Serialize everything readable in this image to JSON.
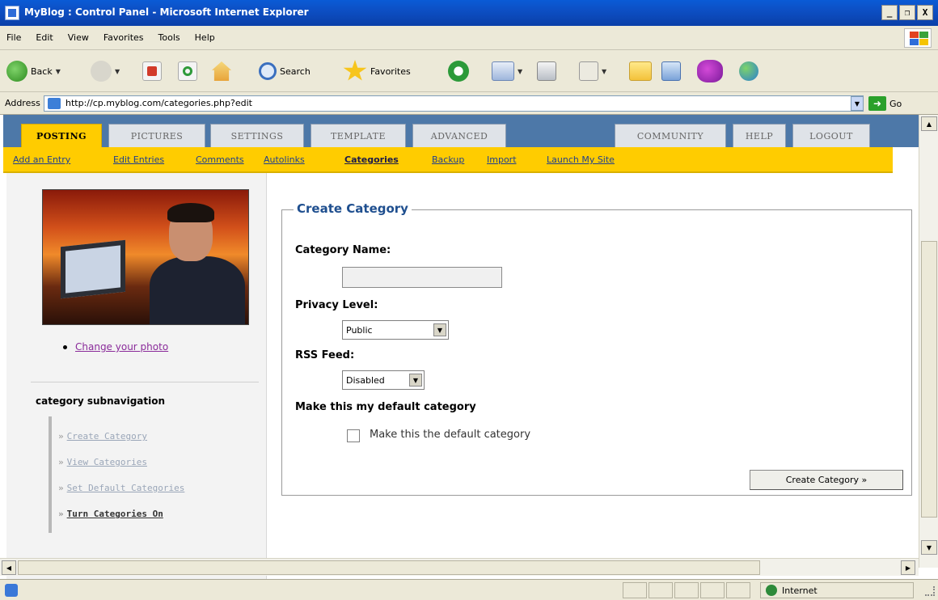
{
  "window": {
    "title": "MyBlog : Control Panel - Microsoft Internet Explorer",
    "buttons": [
      "_",
      "❐",
      "X"
    ]
  },
  "menubar": {
    "items": [
      "File",
      "Edit",
      "View",
      "Favorites",
      "Tools",
      "Help"
    ]
  },
  "toolbar": {
    "back_label": "Back",
    "search_label": "Search",
    "favorites_label": "Favorites"
  },
  "addressbar": {
    "label": "Address",
    "url": "http://cp.myblog.com/categories.php?edit",
    "go_label": "Go"
  },
  "tabs": {
    "left": [
      "POSTING",
      "PICTURES",
      "SETTINGS",
      "TEMPLATE",
      "ADVANCED"
    ],
    "right": [
      "COMMUNITY",
      "HELP",
      "LOGOUT"
    ],
    "active": "POSTING"
  },
  "subnav": {
    "items": [
      "Add an Entry",
      "Edit Entries",
      "Comments",
      "Autolinks",
      "Categories",
      "Backup",
      "Import",
      "Launch My Site"
    ],
    "current": "Categories"
  },
  "sidebar": {
    "change_photo": "Change your photo",
    "subnav_heading": "category subnavigation",
    "subnav_items": [
      "Create Category",
      "View Categories",
      "Set Default Categories",
      "Turn Categories On"
    ],
    "raquo": "»"
  },
  "form": {
    "legend": "Create Category",
    "category_name_label": "Category Name:",
    "category_name_value": "",
    "privacy_label": "Privacy Level:",
    "privacy_value": "Public",
    "rss_label": "RSS Feed:",
    "rss_value": "Disabled",
    "default_heading": "Make this my default category",
    "default_checkbox_label": "Make this the default category",
    "default_checked": false,
    "submit_label": "Create Category »"
  },
  "statusbar": {
    "zone": "Internet"
  }
}
